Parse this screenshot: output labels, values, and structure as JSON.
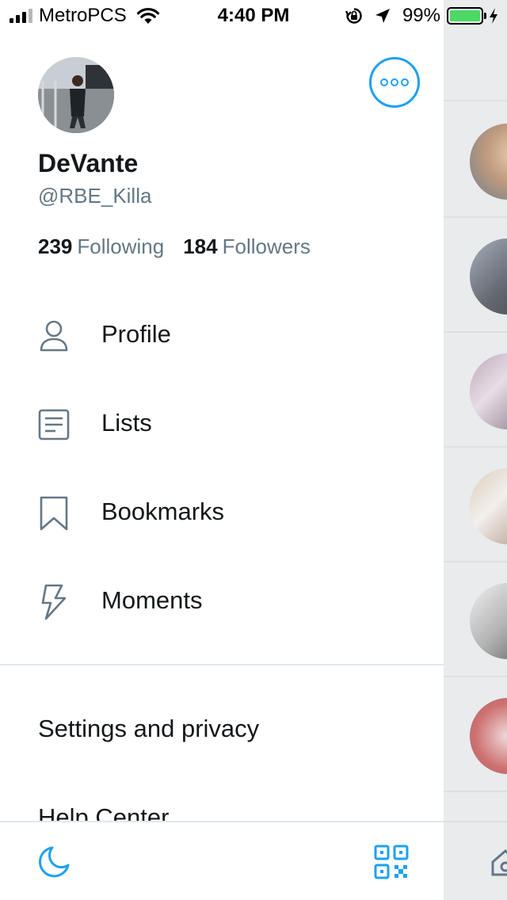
{
  "status_bar": {
    "carrier": "MetroPCS",
    "time": "4:40 PM",
    "battery": "99%",
    "battery_fraction": 0.99
  },
  "profile": {
    "display_name": "DeVante",
    "handle": "@RBE_Killa",
    "following_count": "239",
    "following_label": "Following",
    "followers_count": "184",
    "followers_label": "Followers"
  },
  "menu": {
    "items": [
      {
        "label": "Profile",
        "icon": "person-icon"
      },
      {
        "label": "Lists",
        "icon": "list-icon"
      },
      {
        "label": "Bookmarks",
        "icon": "bookmark-icon"
      },
      {
        "label": "Moments",
        "icon": "lightning-icon"
      }
    ],
    "settings_label": "Settings and privacy",
    "help_label": "Help Center"
  },
  "colors": {
    "accent": "#1da1f2",
    "text_primary": "#14171a",
    "text_secondary": "#657786",
    "battery_green": "#4cd964"
  }
}
